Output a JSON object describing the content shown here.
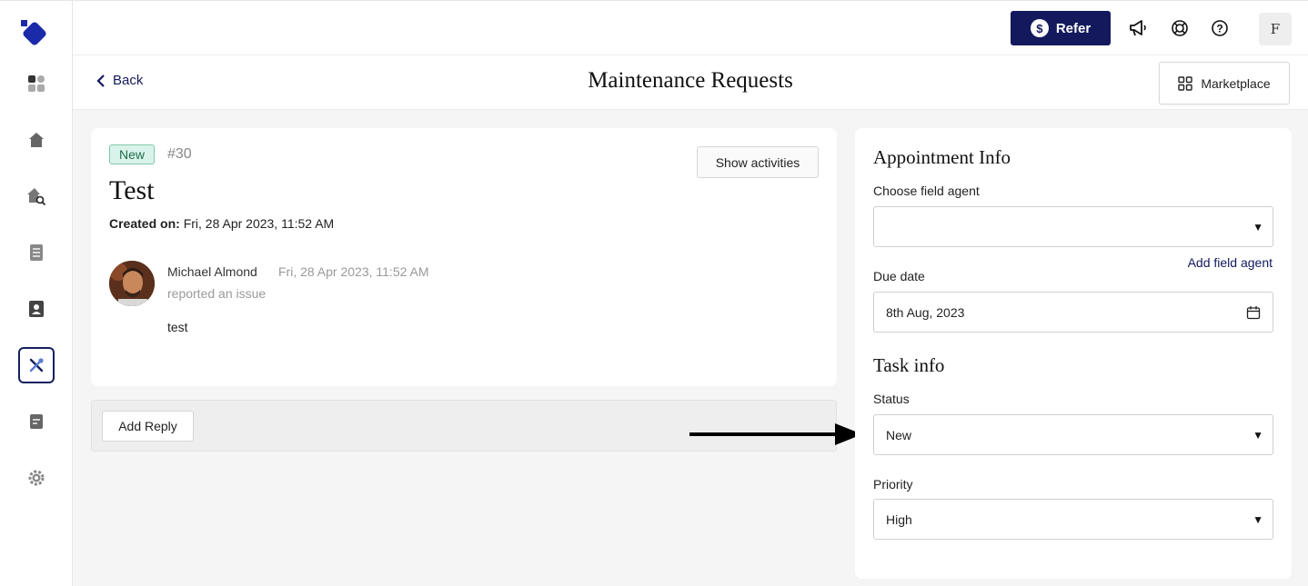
{
  "topbar": {
    "refer_label": "Refer",
    "avatar_initial": "F"
  },
  "subheader": {
    "back_label": "Back",
    "title": "Maintenance Requests",
    "marketplace_label": "Marketplace"
  },
  "request": {
    "status_badge": "New",
    "number": "#30",
    "show_activities_label": "Show activities",
    "title": "Test",
    "created_label": "Created on:",
    "created_value": "Fri, 28 Apr 2023, 11:52 AM",
    "activity": {
      "user_name": "Michael Almond",
      "timestamp": "Fri, 28 Apr 2023, 11:52 AM",
      "action": "reported an issue",
      "message": "test"
    },
    "add_reply_label": "Add Reply"
  },
  "appointment": {
    "section_title": "Appointment Info",
    "field_agent_label": "Choose field agent",
    "field_agent_value": "",
    "add_field_agent_label": "Add field agent",
    "due_date_label": "Due date",
    "due_date_value": "8th Aug, 2023"
  },
  "task": {
    "section_title": "Task info",
    "status_label": "Status",
    "status_value": "New",
    "priority_label": "Priority",
    "priority_value": "High"
  },
  "colors": {
    "brand": "#13195c",
    "badge_bg": "#daf3ea",
    "badge_border": "#7ec9a9"
  },
  "icons": {
    "sidebar": [
      "dashboard-icon",
      "home-icon",
      "home-search-icon",
      "document-list-icon",
      "contacts-icon",
      "tools-icon",
      "report-icon",
      "gear-icon"
    ],
    "topbar": [
      "dollar-icon",
      "megaphone-icon",
      "lifebuoy-icon",
      "help-icon"
    ]
  }
}
